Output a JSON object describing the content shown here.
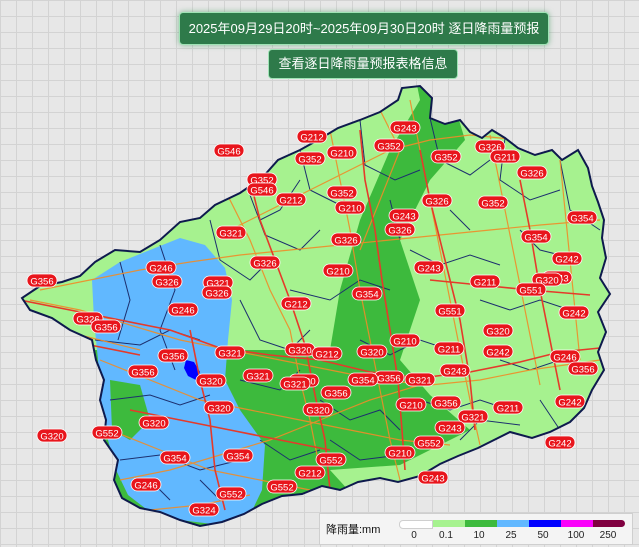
{
  "header": {
    "title": "2025年09月29日20时~2025年09月30日20时   逐日降雨量预报",
    "table_button_label": "查看逐日降雨量预报表格信息"
  },
  "legend": {
    "title": "降雨量:mm",
    "ticks": [
      "0",
      "0.1",
      "10",
      "25",
      "50",
      "100",
      "250"
    ],
    "colors": [
      "#ffffff",
      "#a6f28f",
      "#3dba3d",
      "#61b8ff",
      "#0000ff",
      "#fa00fa",
      "#800040"
    ]
  },
  "map": {
    "road_labels": [
      "G212",
      "G243",
      "G326",
      "G546",
      "G352",
      "G210",
      "G211",
      "G352",
      "G352",
      "G326",
      "G352",
      "G546",
      "G212",
      "G352",
      "G243",
      "G326",
      "G352",
      "G354",
      "G210",
      "G243",
      "G321",
      "G326",
      "G326",
      "G354",
      "G246",
      "G242",
      "G356",
      "G326",
      "G321",
      "G210",
      "G243",
      "G211",
      "G320",
      "G326",
      "G326",
      "G212",
      "G354",
      "G551",
      "G326",
      "G356",
      "G246",
      "G551",
      "G242",
      "G320",
      "G210",
      "G321",
      "G356",
      "G320",
      "G212",
      "G320",
      "G211",
      "G242",
      "G246",
      "G356",
      "G320",
      "G321",
      "G356",
      "G243",
      "G356",
      "G320",
      "G356",
      "G321",
      "G211",
      "G242",
      "G320",
      "G320",
      "G552",
      "G210",
      "G356",
      "G321",
      "G321",
      "G320",
      "G354",
      "G243",
      "G242",
      "G552",
      "G320",
      "G354",
      "G354",
      "G552",
      "G210",
      "G212",
      "G246",
      "G552",
      "G552",
      "G243",
      "G324"
    ]
  }
}
